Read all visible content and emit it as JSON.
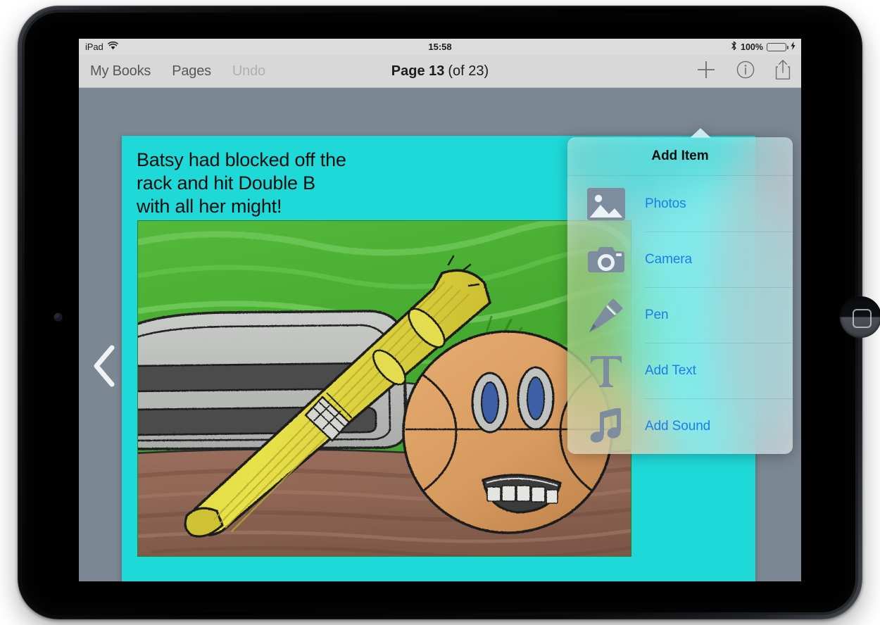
{
  "status_bar": {
    "device_label": "iPad",
    "wifi_icon": "wifi-icon",
    "time": "15:58",
    "bluetooth_icon": "bluetooth-icon",
    "battery_percent": "100%",
    "battery_fill_pct": 100,
    "battery_charging": true,
    "battery_color": "#4cd964"
  },
  "toolbar": {
    "my_books_label": "My Books",
    "pages_label": "Pages",
    "undo_label": "Undo",
    "undo_disabled": true,
    "title_strong": "Page 13",
    "title_light": "(of 23)",
    "add_icon": "plus-icon",
    "info_icon": "info-circle-icon",
    "share_icon": "share-icon"
  },
  "page": {
    "prev_icon": "chevron-left-icon",
    "background_color": "#7b8793",
    "card_color": "#1fd9d9",
    "text": "Batsy had blocked off the\nrack and hit Double B\nwith all her might!",
    "illustration_alt": "Crayon drawing of a yellow baseball bat leaning on a dirt field with a green grass background, a gray baseball rack and a basketball with a face"
  },
  "popover": {
    "title": "Add Item",
    "accent_color": "#1a7fe8",
    "items": [
      {
        "label": "Photos",
        "icon": "photos-icon"
      },
      {
        "label": "Camera",
        "icon": "camera-icon"
      },
      {
        "label": "Pen",
        "icon": "pen-icon"
      },
      {
        "label": "Add Text",
        "icon": "text-icon"
      },
      {
        "label": "Add Sound",
        "icon": "music-note-icon"
      }
    ]
  }
}
